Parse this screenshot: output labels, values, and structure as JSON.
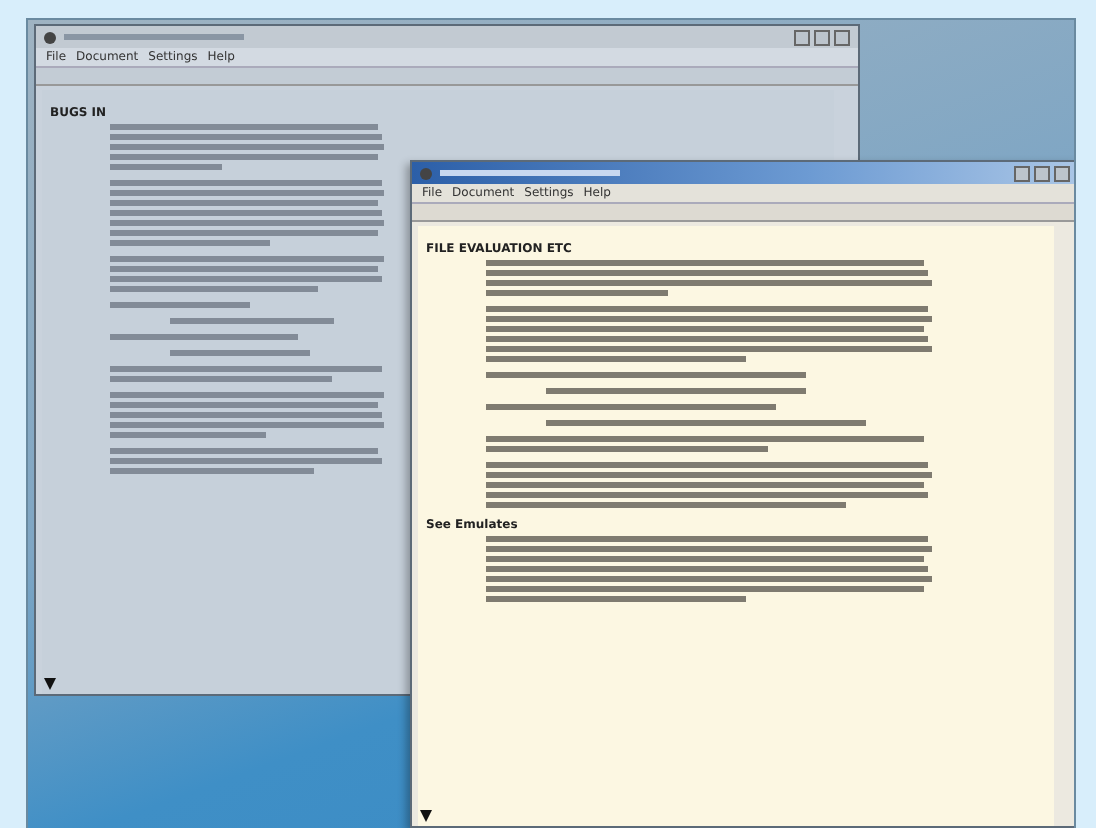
{
  "windows": [
    {
      "active": false,
      "menu": [
        "File",
        "Document",
        "Settings",
        "Help"
      ],
      "sections": [
        {
          "heading": "BUGS IN"
        }
      ]
    },
    {
      "active": true,
      "menu": [
        "File",
        "Document",
        "Settings",
        "Help"
      ],
      "sections": [
        {
          "heading": "FILE EVALUATION ETC"
        },
        {
          "heading": "See Emulates"
        }
      ]
    }
  ]
}
